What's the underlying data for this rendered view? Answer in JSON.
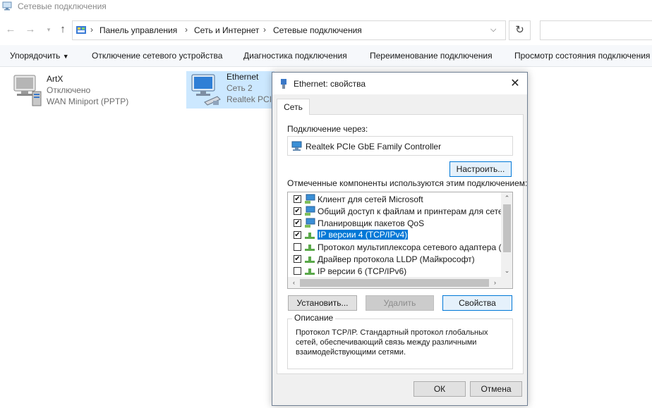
{
  "window": {
    "title": "Сетевые подключения"
  },
  "address": {
    "crumbs": [
      "Панель управления",
      "Сеть и Интернет",
      "Сетевые подключения"
    ],
    "search_placeholder": ""
  },
  "commands": {
    "organize": "Упорядочить",
    "disable": "Отключение сетевого устройства",
    "diagnose": "Диагностика подключения",
    "rename": "Переименование подключения",
    "status": "Просмотр состояния подключения"
  },
  "connections": [
    {
      "name": "ArtX",
      "status": "Отключено",
      "device": "WAN Miniport (PPTP)"
    },
    {
      "name": "Ethernet",
      "status": "Сеть 2",
      "device": "Realtek PCIe"
    }
  ],
  "dialog": {
    "title": "Ethernet: свойства",
    "tab": "Сеть",
    "connect_using_label": "Подключение через:",
    "adapter": "Realtek PCIe GbE Family Controller",
    "configure_button": "Настроить...",
    "components_label": "Отмеченные компоненты используются этим подключением:",
    "components": [
      {
        "label": "Клиент для сетей Microsoft",
        "checked": "✔",
        "icon": "network-client-icon",
        "selected": false
      },
      {
        "label": "Общий доступ к файлам и принтерам для сетей Mi",
        "checked": "✔",
        "icon": "network-share-icon",
        "selected": false
      },
      {
        "label": "Планировщик пакетов QoS",
        "checked": "✔",
        "icon": "network-qos-icon",
        "selected": false
      },
      {
        "label": "IP версии 4 (TCP/IPv4)",
        "checked": "✔",
        "icon": "protocol-icon",
        "selected": true
      },
      {
        "label": "Протокол мультиплексора сетевого адаптера (Май",
        "checked": "",
        "icon": "protocol-icon",
        "selected": false
      },
      {
        "label": "Драйвер протокола LLDP (Майкрософт)",
        "checked": "✔",
        "icon": "protocol-icon",
        "selected": false
      },
      {
        "label": "IP версии 6 (TCP/IPv6)",
        "checked": "",
        "icon": "protocol-icon",
        "selected": false
      }
    ],
    "install_button": "Установить...",
    "remove_button": "Удалить",
    "properties_button": "Свойства",
    "description_legend": "Описание",
    "description_text": "Протокол TCP/IP. Стандартный протокол глобальных сетей, обеспечивающий связь между различными взаимодействующими сетями.",
    "ok_button": "ОК",
    "cancel_button": "Отмена"
  },
  "colors": {
    "selection": "#0078d7",
    "command_bar_bg": "#f6f8fb",
    "dialog_bg": "#f0f0f0"
  }
}
